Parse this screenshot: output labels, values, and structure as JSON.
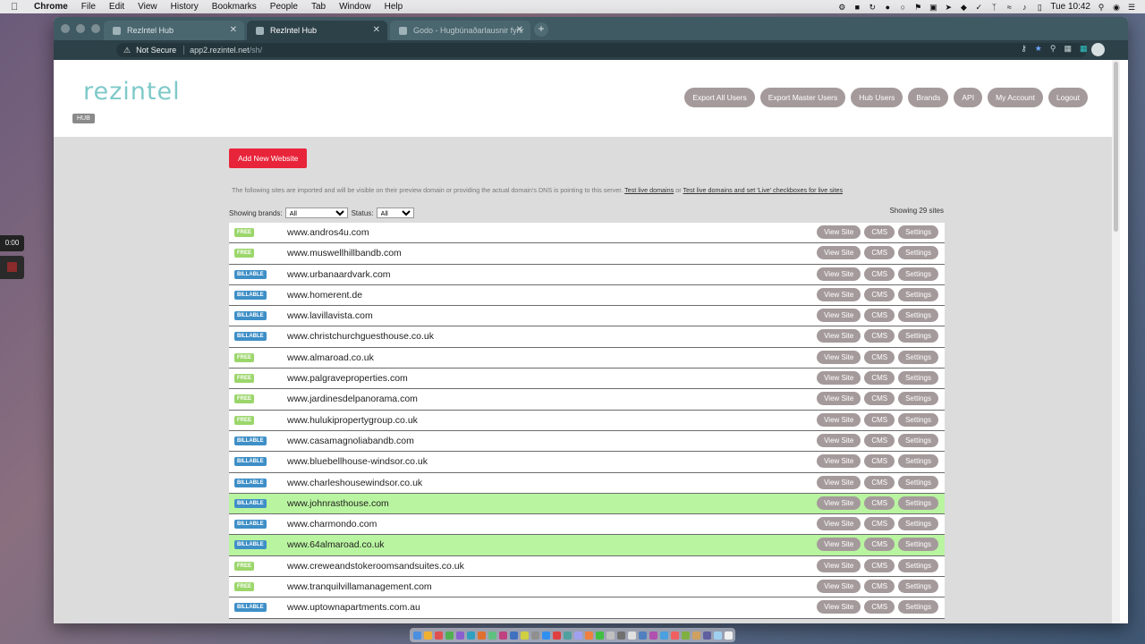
{
  "menubar": {
    "app": "Chrome",
    "items": [
      "File",
      "Edit",
      "View",
      "History",
      "Bookmarks",
      "People",
      "Tab",
      "Window",
      "Help"
    ],
    "clock": "Tue 10:42"
  },
  "browser": {
    "tabs": [
      {
        "title": "RezIntel Hub"
      },
      {
        "title": "RezIntel Hub"
      },
      {
        "title": "Godo - Hugbúnaðarlausnir fyrir"
      }
    ],
    "address": {
      "security": "Not Secure",
      "host": "app2.rezintel.net",
      "path": "/sh/"
    }
  },
  "header": {
    "logo": "rezintel",
    "badge": "HUB",
    "nav": [
      "Export All Users",
      "Export Master Users",
      "Hub Users",
      "Brands",
      "API",
      "My Account",
      "Logout"
    ]
  },
  "content": {
    "add_button": "Add New Website",
    "info_text": "The following sites are imported and will be visible on their preview domain or providing the actual domain's DNS is pointing to this server.",
    "link_test": "Test live domains",
    "or": "or",
    "link_test_set": "Test live domains and set 'Live' checkboxes for live sites",
    "showing_brands_label": "Showing brands:",
    "brands_value": "All",
    "status_label": "Status:",
    "status_value": "All",
    "count": "Showing 29 sites"
  },
  "actions": {
    "view": "View Site",
    "cms": "CMS",
    "settings": "Settings"
  },
  "sites": [
    {
      "plan": "FREE",
      "domain": "www.andros4u.com",
      "live": false
    },
    {
      "plan": "FREE",
      "domain": "www.muswellhillbandb.com",
      "live": false
    },
    {
      "plan": "BILLABLE",
      "domain": "www.urbanaardvark.com",
      "live": false
    },
    {
      "plan": "BILLABLE",
      "domain": "www.homerent.de",
      "live": false
    },
    {
      "plan": "BILLABLE",
      "domain": "www.lavillavista.com",
      "live": false
    },
    {
      "plan": "BILLABLE",
      "domain": "www.christchurchguesthouse.co.uk",
      "live": false
    },
    {
      "plan": "FREE",
      "domain": "www.almaroad.co.uk",
      "live": false
    },
    {
      "plan": "FREE",
      "domain": "www.palgraveproperties.com",
      "live": false
    },
    {
      "plan": "FREE",
      "domain": "www.jardinesdelpanorama.com",
      "live": false
    },
    {
      "plan": "FREE",
      "domain": "www.hulukipropertygroup.co.uk",
      "live": false
    },
    {
      "plan": "BILLABLE",
      "domain": "www.casamagnoliabandb.com",
      "live": false
    },
    {
      "plan": "BILLABLE",
      "domain": "www.bluebellhouse-windsor.co.uk",
      "live": false
    },
    {
      "plan": "BILLABLE",
      "domain": "www.charleshousewindsor.co.uk",
      "live": false
    },
    {
      "plan": "BILLABLE",
      "domain": "www.johnrasthouse.com",
      "live": true
    },
    {
      "plan": "BILLABLE",
      "domain": "www.charmondo.com",
      "live": false
    },
    {
      "plan": "BILLABLE",
      "domain": "www.64almaroad.co.uk",
      "live": true
    },
    {
      "plan": "FREE",
      "domain": "www.creweandstokeroomsandsuites.co.uk",
      "live": false
    },
    {
      "plan": "FREE",
      "domain": "www.tranquilvillamanagement.com",
      "live": false
    },
    {
      "plan": "BILLABLE",
      "domain": "www.uptownapartments.com.au",
      "live": false
    }
  ],
  "overlay": {
    "timer": "0:00"
  },
  "colors": {
    "accent_red": "#e8243a",
    "logo_teal": "#7fc9c9",
    "billable_blue": "#3e8fc7",
    "free_green": "#9bd66b",
    "live_green": "#b9f5a0"
  }
}
